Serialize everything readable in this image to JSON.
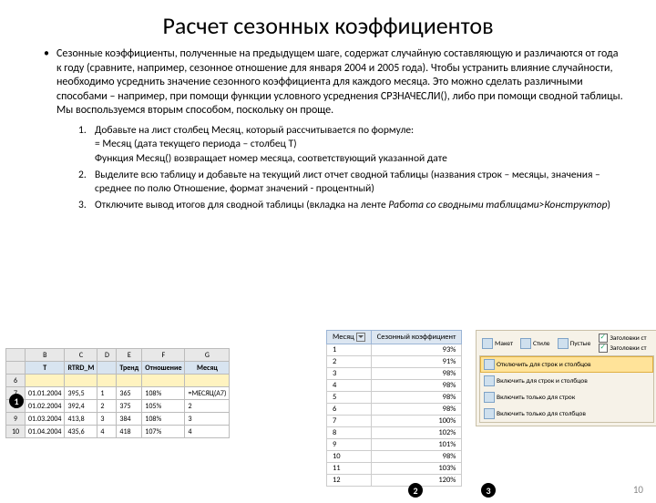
{
  "title": "Расчет сезонных коэффициентов",
  "bullet": "Сезонные коэффициенты, полученные на предыдущем шаге, содержат случайную составляющую и различаются от года к году (сравните, например, сезонное отношение для января 2004 и 2005 года). Чтобы устранить влияние случайности, необходимо усреднить значение сезонного коэффициента для каждого месяца. Это можно сделать различными способами – например, при помощи функции условного усреднения СРЗНАЧЕСЛИ(), либо при помощи сводной таблицы. Мы воспользуемся вторым способом, поскольку он проще.",
  "steps": [
    {
      "n": "1.",
      "t": "Добавьте на лист столбец Месяц, который рассчитывается по формуле:\n= Месяц (дата текущего периода – столбец T)\nФункция Месяц() возвращает номер месяца, соответствующий указанной дате"
    },
    {
      "n": "2.",
      "t": "Выделите всю таблицу и добавьте на текущий лист отчет сводной таблицы (названия строк – месяцы, значения – среднее по полю Отношение, формат значений - процентный)"
    },
    {
      "n": "3.",
      "t1": "Отключите вывод итогов для сводной таблицы (вкладка на ленте ",
      "em": "Работа со сводными таблицами>Конструктор",
      "t2": ")"
    }
  ],
  "excel1": {
    "cols": [
      "",
      "B",
      "C",
      "D",
      "E",
      "F",
      "G"
    ],
    "head": [
      "",
      "T",
      "RTRD_M",
      "",
      "Тренд",
      "Отношение",
      "Месяц"
    ],
    "rows": [
      {
        "r": "6",
        "ylw": true
      },
      {
        "r": "7",
        "d": [
          "",
          "01.01.2004",
          "395,5",
          "1",
          "365",
          "108%",
          "=МЕСЯЦ(A7)"
        ]
      },
      {
        "r": "8",
        "d": [
          "",
          "01.02.2004",
          "392,4",
          "2",
          "375",
          "105%",
          "2"
        ]
      },
      {
        "r": "9",
        "d": [
          "",
          "01.03.2004",
          "413,8",
          "3",
          "384",
          "108%",
          "3"
        ]
      },
      {
        "r": "10",
        "d": [
          "",
          "01.04.2004",
          "435,6",
          "4",
          "418",
          "107%",
          "4"
        ]
      }
    ]
  },
  "pivot": {
    "h1": "Месяц",
    "h2": "Сезонный коэффициент",
    "rows": [
      [
        "1",
        "93%"
      ],
      [
        "2",
        "91%"
      ],
      [
        "3",
        "98%"
      ],
      [
        "4",
        "98%"
      ],
      [
        "5",
        "98%"
      ],
      [
        "6",
        "98%"
      ],
      [
        "7",
        "100%"
      ],
      [
        "8",
        "102%"
      ],
      [
        "9",
        "101%"
      ],
      [
        "10",
        "98%"
      ],
      [
        "11",
        "103%"
      ],
      [
        "12",
        "120%"
      ]
    ]
  },
  "ribbon": {
    "big": [
      {
        "lbl": "Макет"
      },
      {
        "lbl": "Стиле"
      },
      {
        "lbl": "Пустые"
      }
    ],
    "chk": [
      {
        "on": true,
        "t": "Заголовки ст"
      },
      {
        "on": true,
        "t": "Заголовки ст"
      }
    ],
    "menu": [
      {
        "t": "Отключить для строк и столбцов",
        "hl": true
      },
      {
        "t": "Включить для строк и столбцов"
      },
      {
        "t": "Включить только для строк"
      },
      {
        "t": "Включить только для столбцов"
      }
    ]
  },
  "badges": {
    "b1": "1",
    "b2": "2",
    "b3": "3"
  },
  "page": "10"
}
